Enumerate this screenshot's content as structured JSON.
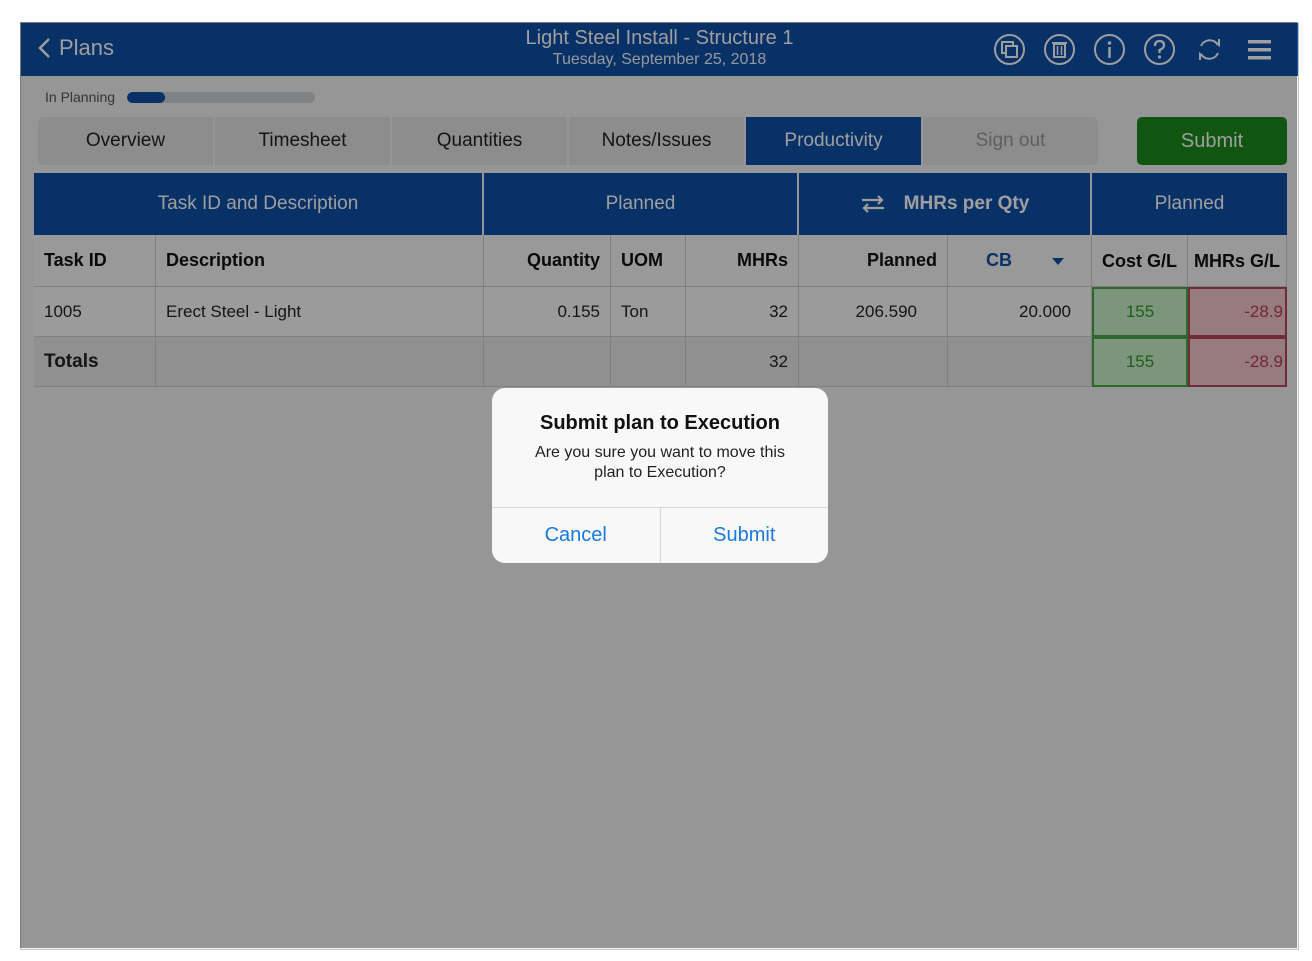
{
  "header": {
    "back_label": "Plans",
    "title": "Light Steel Install - Structure 1",
    "date": "Tuesday, September 25, 2018",
    "icons": [
      "copy-icon",
      "trash-icon",
      "info-icon",
      "help-icon",
      "refresh-icon",
      "menu-icon"
    ]
  },
  "status": {
    "label": "In Planning",
    "progress": 0.2
  },
  "tabs": [
    {
      "label": "Overview"
    },
    {
      "label": "Timesheet"
    },
    {
      "label": "Quantities"
    },
    {
      "label": "Notes/Issues"
    },
    {
      "label": "Productivity",
      "active": true
    },
    {
      "label": "Sign out"
    }
  ],
  "submit_label": "Submit",
  "table": {
    "groups": {
      "task": "Task ID and Description",
      "planned": "Planned",
      "mhrs_per_qty": "MHRs per Qty",
      "planned2": "Planned"
    },
    "columns": {
      "task_id": "Task ID",
      "description": "Description",
      "quantity": "Quantity",
      "uom": "UOM",
      "mhrs": "MHRs",
      "planned": "Planned",
      "cb": "CB",
      "cost_gl": "Cost G/L",
      "mhrs_gl": "MHRs G/L"
    },
    "row": {
      "task_id": "1005",
      "description": "Erect Steel - Light",
      "quantity": "0.155",
      "uom": "Ton",
      "mhrs": "32",
      "planned": "206.590",
      "cb": "20.000",
      "cost_gl": "155",
      "mhrs_gl": "-28.9"
    },
    "totals": {
      "label": "Totals",
      "mhrs": "32",
      "cost_gl": "155",
      "mhrs_gl": "-28.9"
    }
  },
  "dialog": {
    "title": "Submit plan to Execution",
    "message": "Are you sure you want to move this plan to Execution?",
    "cancel": "Cancel",
    "submit": "Submit"
  },
  "colors": {
    "brand_blue": "#0e4fa6",
    "submit_green": "#1a8a1a",
    "gain_green": "#2e9a2e",
    "loss_red": "#c0404b",
    "ios_blue": "#1a7ae0"
  }
}
